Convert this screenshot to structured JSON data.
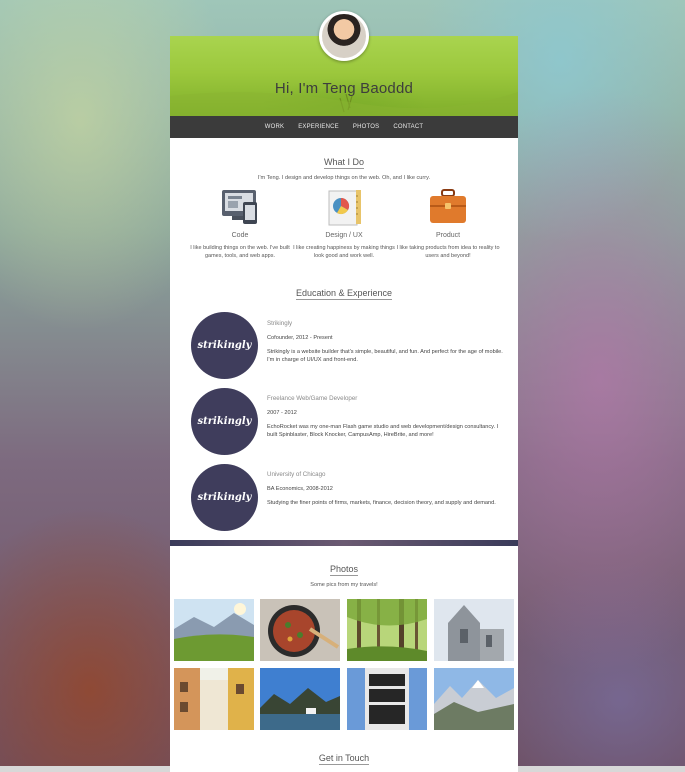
{
  "hero": {
    "title": "Hi, I'm Teng Baoddd"
  },
  "nav": {
    "items": [
      "WORK",
      "EXPERIENCE",
      "PHOTOS",
      "CONTACT"
    ]
  },
  "what_i_do": {
    "title": "What I Do",
    "intro": "I'm Teng. I design and develop things on the web. Oh, and I like curry.",
    "skills": [
      {
        "name": "Code",
        "desc": "I like building things on the web. I've built games, tools, and web apps.",
        "icon": "computer-icon"
      },
      {
        "name": "Design / UX",
        "desc": "I like creating happiness by making things look good and work well.",
        "icon": "design-icon"
      },
      {
        "name": "Product",
        "desc": "I like taking products from idea to reality to users and beyond!",
        "icon": "briefcase-icon"
      }
    ]
  },
  "experience": {
    "title": "Education & Experience",
    "logo_text": "strikingly",
    "items": [
      {
        "org": "Strikingly",
        "role": "Cofounder, 2012 - Present",
        "desc": "Strikingly is a website builder that's simple, beautiful, and fun. And perfect for the age of mobile. I'm in charge of UI/UX and front-end."
      },
      {
        "org": "Freelance Web/Game Developer",
        "role": "2007 - 2012",
        "desc": "EchoRocket was my one-man Flash game studio and web development/design consultancy. I built Spinblaster, Block Knocker, CampusAmp, HireBrite, and more!"
      },
      {
        "org": "University of Chicago",
        "role": "BA Economics, 2008-2012",
        "desc": "Studying the finer points of firms, markets, finance, decision theory, and supply and demand."
      }
    ]
  },
  "photos": {
    "title": "Photos",
    "subtitle": "Some pics from my travels!",
    "items": [
      "mountain-meadow-photo",
      "cooking-pan-photo",
      "forest-photo",
      "cathedral-photo",
      "alley-photo",
      "lake-mountains-photo",
      "building-photo",
      "alps-photo"
    ]
  },
  "contact": {
    "title": "Get in Touch"
  }
}
